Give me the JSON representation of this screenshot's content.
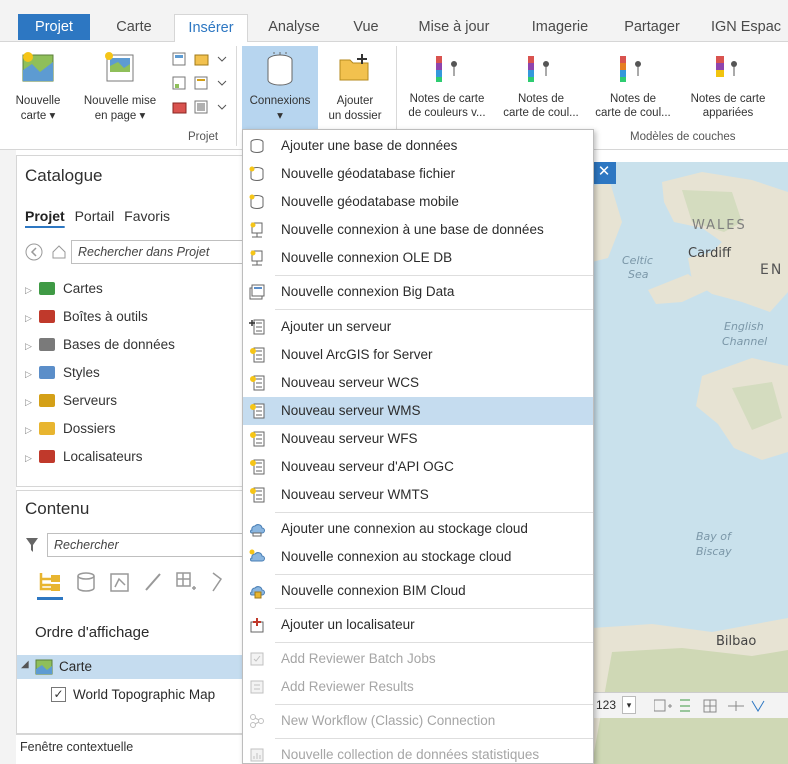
{
  "tabs": [
    {
      "label": "Projet"
    },
    {
      "label": "Carte"
    },
    {
      "label": "Insérer"
    },
    {
      "label": "Analyse"
    },
    {
      "label": "Vue"
    },
    {
      "label": "Mise à jour"
    },
    {
      "label": "Imagerie"
    },
    {
      "label": "Partager"
    },
    {
      "label": "IGN Espac"
    }
  ],
  "ribbon": {
    "new_map": {
      "line1": "Nouvelle",
      "line2": "carte ▾"
    },
    "new_layout": {
      "line1": "Nouvelle mise",
      "line2": "en page ▾"
    },
    "projet_group": "Projet",
    "connexions": {
      "line1": "Connexions",
      "line2": "▾"
    },
    "add_folder": {
      "line1": "Ajouter",
      "line2": "un dossier"
    },
    "layer_templates": [
      {
        "line1": "Notes de carte",
        "line2": "de couleurs v..."
      },
      {
        "line1": "Notes de",
        "line2": "carte de coul..."
      },
      {
        "line1": "Notes de",
        "line2": "carte de coul..."
      },
      {
        "line1": "Notes de carte",
        "line2": "appariées"
      }
    ],
    "templates_group": "Modèles de couches"
  },
  "catalogue": {
    "title": "Catalogue",
    "subtabs": [
      "Projet",
      "Portail",
      "Favoris"
    ],
    "search_placeholder": "Rechercher dans Projet",
    "items": [
      {
        "label": "Cartes",
        "color": "#3f9a45"
      },
      {
        "label": "Boîtes à outils",
        "color": "#c0392b"
      },
      {
        "label": "Bases de données",
        "color": "#7a7a7a"
      },
      {
        "label": "Styles",
        "color": "#5b8ec9"
      },
      {
        "label": "Serveurs",
        "color": "#d4a017"
      },
      {
        "label": "Dossiers",
        "color": "#e8b530"
      },
      {
        "label": "Localisateurs",
        "color": "#c0392b"
      }
    ]
  },
  "contenu": {
    "title": "Contenu",
    "search_placeholder": "Rechercher",
    "display_order": "Ordre d'affichage",
    "map_node": "Carte",
    "layer": "World Topographic Map"
  },
  "context_window": "Fenêtre contextuelle",
  "map": {
    "labels": {
      "wales": "WALES",
      "cardiff": "Cardiff",
      "en": "EN",
      "celtic_sea": "Celtic Sea",
      "celtic": "Celtic",
      "sea": "Sea",
      "english": "English",
      "channel": "Channel",
      "bay_of": "Bay of",
      "biscay": "Biscay",
      "bilbao": "Bilbao"
    },
    "scale": "123"
  },
  "menu": {
    "items": [
      {
        "label": "Ajouter une base de données",
        "state": "normal"
      },
      {
        "label": "Nouvelle géodatabase fichier",
        "state": "normal"
      },
      {
        "label": "Nouvelle géodatabase mobile",
        "state": "normal"
      },
      {
        "label": "Nouvelle connexion à une base de données",
        "state": "normal"
      },
      {
        "label": "Nouvelle connexion OLE DB",
        "state": "normal"
      },
      {
        "label": "Nouvelle connexion Big Data",
        "state": "normal"
      },
      {
        "label": "Ajouter un serveur",
        "state": "normal"
      },
      {
        "label": "Nouvel ArcGIS for Server",
        "state": "normal"
      },
      {
        "label": "Nouveau serveur WCS",
        "state": "normal"
      },
      {
        "label": "Nouveau serveur WMS",
        "state": "highlighted"
      },
      {
        "label": "Nouveau serveur WFS",
        "state": "normal"
      },
      {
        "label": "Nouveau serveur d'API OGC",
        "state": "normal"
      },
      {
        "label": "Nouveau serveur WMTS",
        "state": "normal"
      },
      {
        "label": "Ajouter une connexion au stockage cloud",
        "state": "normal"
      },
      {
        "label": "Nouvelle connexion au stockage cloud",
        "state": "normal"
      },
      {
        "label": "Nouvelle connexion BIM Cloud",
        "state": "normal"
      },
      {
        "label": "Ajouter un localisateur",
        "state": "normal"
      },
      {
        "label": "Add Reviewer Batch Jobs",
        "state": "disabled"
      },
      {
        "label": "Add Reviewer Results",
        "state": "disabled"
      },
      {
        "label": "New Workflow (Classic) Connection",
        "state": "disabled"
      },
      {
        "label": "Nouvelle collection de données statistiques",
        "state": "disabled"
      }
    ]
  },
  "colors": {
    "accent": "#2d77c2",
    "highlight": "#c5dcef",
    "ribbon_active": "#b7d5ef"
  }
}
